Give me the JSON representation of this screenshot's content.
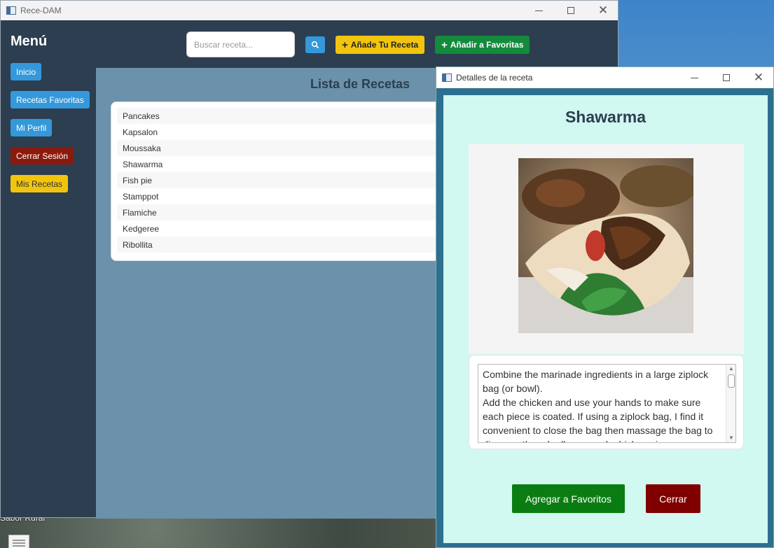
{
  "main_window": {
    "title": "Rece-DAM",
    "menu_title": "Menú",
    "sidebar": {
      "items": [
        {
          "label": "Inicio",
          "color": "#3498db"
        },
        {
          "label": "Recetas Favoritas",
          "color": "#3498db"
        },
        {
          "label": "Mi Perfil",
          "color": "#3498db"
        },
        {
          "label": "Cerrar Sesión",
          "color": "#8b1a0e"
        },
        {
          "label": "Mis Recetas",
          "color": "#f1c40f"
        }
      ]
    },
    "toolbar": {
      "search_placeholder": "Buscar receta...",
      "search_icon": "search-icon",
      "add_recipe_label": "Añade Tu Receta",
      "add_favorites_label": "Añadir a Favoritas"
    },
    "list": {
      "title": "Lista de Recetas",
      "items": [
        "Pancakes",
        "Kapsalon",
        "Moussaka",
        "Shawarma",
        "Fish pie",
        "Stamppot",
        "Flamiche",
        "Kedgeree",
        "Ribollita"
      ]
    }
  },
  "detail_window": {
    "title": "Detalles de la receta",
    "recipe_name": "Shawarma",
    "image_alt": "shawarma-photo",
    "description": "Combine the marinade ingredients in a large ziplock bag (or bowl).\nAdd the chicken and use your hands to make sure each piece is coated. If using a ziplock bag, I find it convenient to close the bag then massage the bag to disperse the rub all over each chicken piece.",
    "add_favorite_label": "Agregar a Favoritos",
    "close_label": "Cerrar"
  },
  "desktop": {
    "label": "Sabor Rural"
  }
}
